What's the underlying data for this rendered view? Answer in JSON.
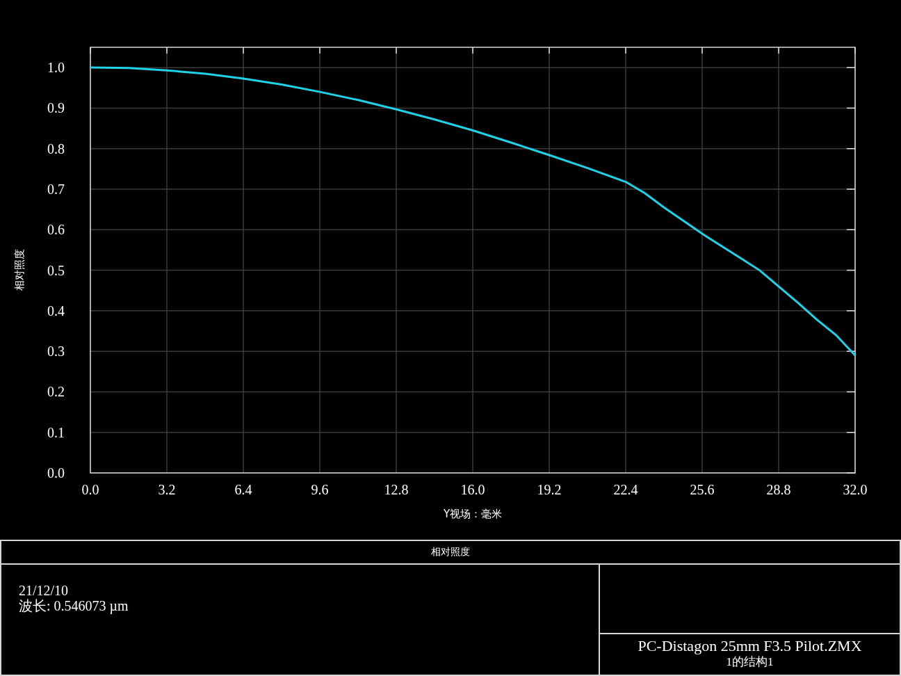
{
  "chart": {
    "chart_data": {
      "type": "line",
      "xlabel": "Y视场：毫米",
      "ylabel": "相对照度",
      "grid": true,
      "xlim": [
        0,
        32
      ],
      "ylim": [
        0,
        1.05
      ],
      "xticks": [
        {
          "value": 0,
          "label": "0.0"
        },
        {
          "value": 3.2,
          "label": "3.2"
        },
        {
          "value": 6.4,
          "label": "6.4"
        },
        {
          "value": 9.6,
          "label": "9.6"
        },
        {
          "value": 12.8,
          "label": "12.8"
        },
        {
          "value": 16,
          "label": "16.0"
        },
        {
          "value": 19.2,
          "label": "19.2"
        },
        {
          "value": 22.4,
          "label": "22.4"
        },
        {
          "value": 25.6,
          "label": "25.6"
        },
        {
          "value": 28.8,
          "label": "28.8"
        },
        {
          "value": 32,
          "label": "32.0"
        }
      ],
      "yticks": [
        {
          "value": 0,
          "label": "0.0"
        },
        {
          "value": 0.1,
          "label": "0.1"
        },
        {
          "value": 0.2,
          "label": "0.2"
        },
        {
          "value": 0.3,
          "label": "0.3"
        },
        {
          "value": 0.4,
          "label": "0.4"
        },
        {
          "value": 0.5,
          "label": "0.5"
        },
        {
          "value": 0.6,
          "label": "0.6"
        },
        {
          "value": 0.7,
          "label": "0.7"
        },
        {
          "value": 0.8,
          "label": "0.8"
        },
        {
          "value": 0.9,
          "label": "0.9"
        },
        {
          "value": 1,
          "label": "1.0"
        }
      ],
      "x": [
        0,
        1.6,
        3.2,
        4.8,
        6.4,
        8.0,
        9.6,
        11.2,
        12.8,
        14.4,
        16.0,
        17.6,
        19.2,
        20.8,
        22.4,
        23.2,
        24.0,
        25.6,
        27.2,
        28.0,
        28.8,
        29.6,
        30.4,
        31.2,
        32.0
      ],
      "series": [
        {
          "color": "#1ed2e8",
          "values": [
            1.0,
            0.999,
            0.993,
            0.985,
            0.973,
            0.958,
            0.94,
            0.92,
            0.897,
            0.872,
            0.845,
            0.815,
            0.784,
            0.752,
            0.718,
            0.69,
            0.655,
            0.59,
            0.53,
            0.5,
            0.46,
            0.42,
            0.378,
            0.34,
            0.29
          ]
        }
      ]
    }
  },
  "info_table": {
    "title": "相对照度",
    "date": "21/12/10",
    "wavelength": "波长: 0.546073 µm",
    "file_name": "PC-Distagon 25mm F3.5 Pilot.ZMX",
    "configuration": "1的结构1"
  }
}
